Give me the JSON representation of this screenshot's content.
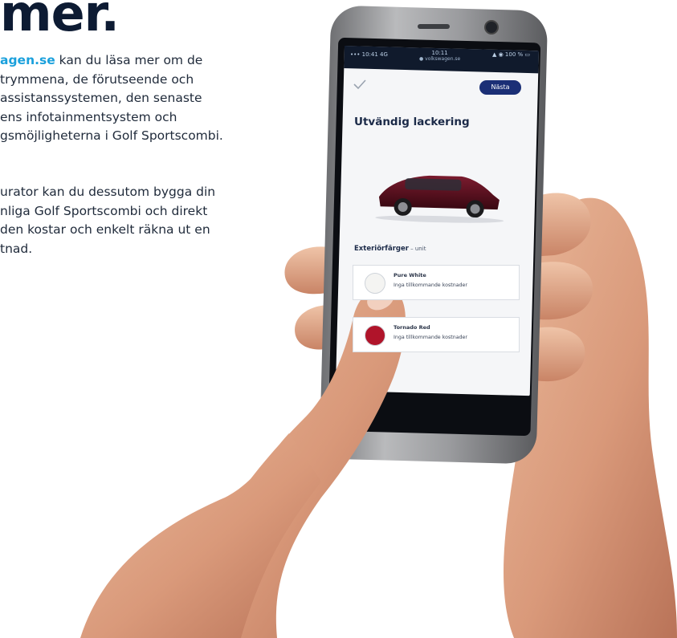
{
  "article": {
    "headline": "mer.",
    "paragraph1_link": "agen.se",
    "paragraph1_lines": [
      " kan du läsa mer om de",
      "trymmena, de förutseende och",
      "assistanssystemen, den senaste",
      "ens infotainmentsystem och",
      "gsmöjligheterna i Golf Sportscombi."
    ],
    "paragraph2_lines": [
      "urator kan du dessutom bygga din",
      "nliga Golf Sportscombi och direkt",
      "den kostar och enkelt räkna ut en",
      "tnad."
    ]
  },
  "phone": {
    "status_bar": {
      "left": "••• 10:41 4G",
      "time": "10:11",
      "url": "● volkswagen.se",
      "right": "▲ ◉ 100 % ▭"
    },
    "app": {
      "next_button": "Nästa",
      "title": "Utvändig lackering",
      "section_label": "Exteriörfärger",
      "section_unit": " – unit",
      "colors": [
        {
          "name": "Pure White",
          "cost": "Inga tillkommande kostnader",
          "swatch": "#f4f4f2"
        },
        {
          "name": "Tornado Red",
          "cost": "Inga tillkommande kostnader",
          "swatch": "#b0142a"
        }
      ]
    }
  },
  "colors": {
    "accent_link": "#1aa0dc",
    "headline": "#0d1b33",
    "button": "#1b2f76",
    "car_body": "#4a0d1c"
  }
}
